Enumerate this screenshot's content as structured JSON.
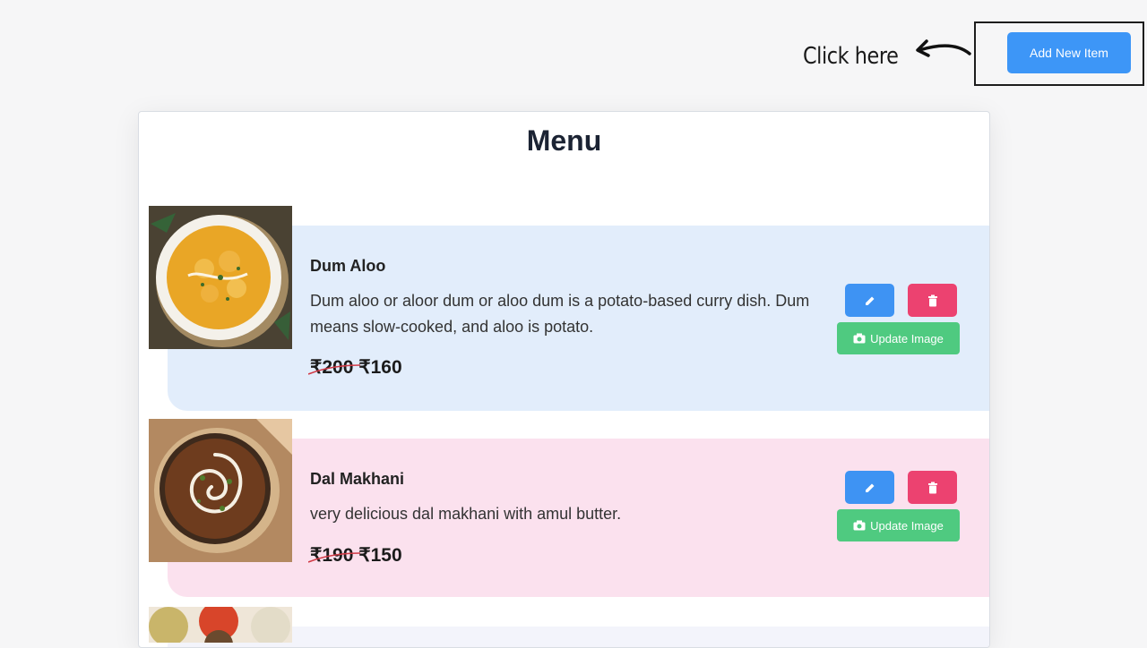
{
  "header": {
    "hint": "Click here",
    "add_button": "Add New Item"
  },
  "menu": {
    "title": "Menu",
    "items": [
      {
        "name": "Dum Aloo",
        "description": "Dum aloo or aloor dum or aloo dum is a potato-based curry dish. Dum means slow-cooked, and aloo is potato.",
        "old_price": "₹200",
        "price": "₹160",
        "update_label": "Update Image",
        "bg_color": "#e2edfb"
      },
      {
        "name": "Dal Makhani",
        "description": "very delicious dal makhani with amul butter.",
        "old_price": "₹190",
        "price": "₹150",
        "update_label": "Update Image",
        "bg_color": "#fbe1ee"
      }
    ]
  },
  "colors": {
    "accent_blue": "#3d96f7",
    "delete_red": "#ec4270",
    "update_green": "#4fca80"
  }
}
